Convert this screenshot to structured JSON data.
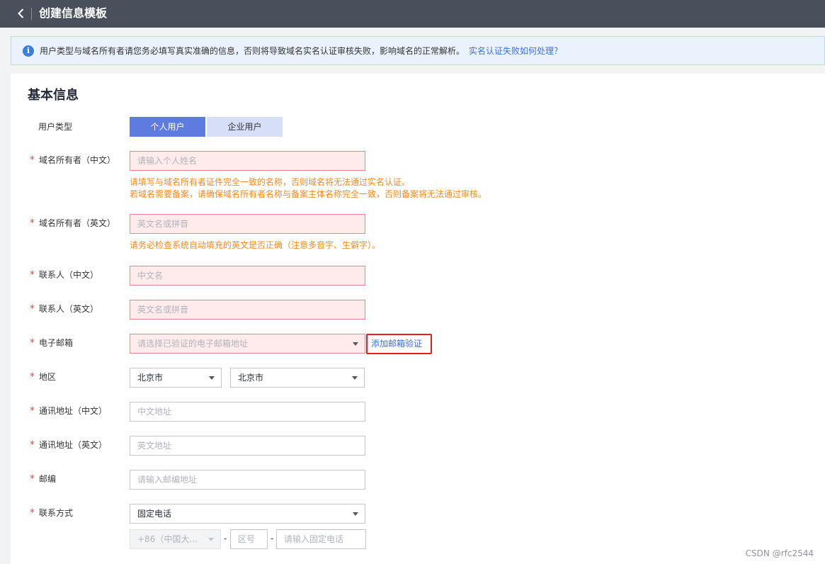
{
  "topbar": {
    "title": "创建信息模板",
    "back_icon": "chevron-left-icon"
  },
  "notice": {
    "icon": "info-icon",
    "icon_glyph": "i",
    "message": "用户类型与域名所有者请您务必填写真实准确的信息，否则将导致域名实名认证审核失败，影响域名的正常解析。",
    "link": "实名认证失败如何处理？"
  },
  "section": {
    "title": "基本信息"
  },
  "user_type": {
    "label": "用户类型",
    "options": [
      "个人用户",
      "企业用户"
    ],
    "selected": "个人用户"
  },
  "fields": {
    "owner_cn": {
      "label": "域名所有者（中文）",
      "placeholder": "请输入个人姓名",
      "hints": [
        "请填写与域名所有者证件完全一致的名称，否则域名将无法通过实名认证。",
        "若域名需要备案，请确保域名所有者名称与备案主体名称完全一致，否则备案将无法通过审核。"
      ]
    },
    "owner_en": {
      "label": "域名所有者（英文）",
      "placeholder": "英文名或拼音",
      "hint": "请务必检查系统自动填充的英文是否正确（注意多音字、生僻字）。"
    },
    "contact_cn": {
      "label": "联系人（中文）",
      "placeholder": "中文名"
    },
    "contact_en": {
      "label": "联系人（英文）",
      "placeholder": "英文名或拼音"
    },
    "email": {
      "label": "电子邮箱",
      "placeholder": "请选择已验证的电子邮箱地址",
      "action": "添加邮箱验证"
    },
    "region": {
      "label": "地区",
      "province": "北京市",
      "city": "北京市"
    },
    "address_cn": {
      "label": "通讯地址（中文）",
      "placeholder": "中文地址"
    },
    "address_en": {
      "label": "通讯地址（英文）",
      "placeholder": "英文地址"
    },
    "postcode": {
      "label": "邮编",
      "placeholder": "请输入邮编地址"
    },
    "contact_method": {
      "label": "联系方式",
      "selected": "固定电话",
      "country_code": "+86（中国大…",
      "separator": "-",
      "area_placeholder": "区号",
      "phone_placeholder": "请输入固定电话"
    }
  },
  "required_mark": "*",
  "watermark": "CSDN @rfc2544",
  "colors": {
    "primary": "#5e7ce0",
    "error_border": "#f0808b",
    "error_bg": "#ffebeb",
    "hint": "#f08a24",
    "link": "#3c6fd6",
    "topbar": "#4a4f5c"
  }
}
